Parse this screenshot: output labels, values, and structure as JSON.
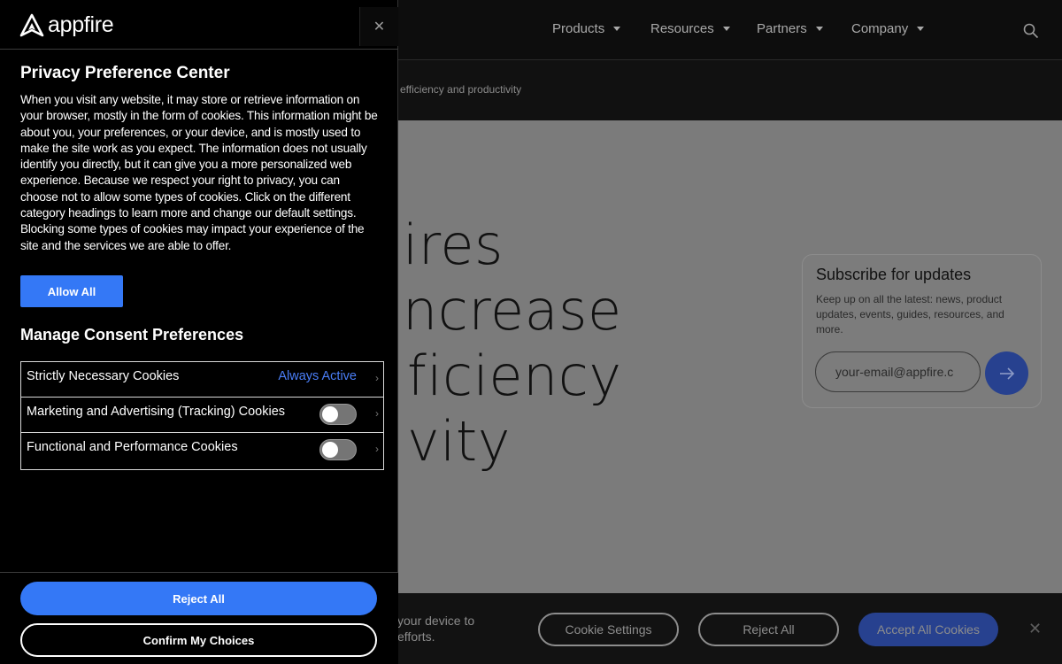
{
  "site": {
    "nav": {
      "items": [
        {
          "label": "Products"
        },
        {
          "label": "Resources"
        },
        {
          "label": "Partners"
        },
        {
          "label": "Company"
        }
      ]
    },
    "subbar_text": "w efficiency and productivity",
    "hero_lines": [
      "ires",
      "ncrease",
      "ficiency",
      "vity"
    ],
    "subscribe": {
      "title": "Subscribe for updates",
      "text": "Keep up on all the latest: news, product updates, events, guides, resources, and more.",
      "email_placeholder": "your-email@appfire.c"
    },
    "cookie_bar": {
      "text": "your device to efforts.",
      "settings_label": "Cookie Settings",
      "reject_label": "Reject All",
      "accept_label": "Accept All Cookies"
    }
  },
  "panel": {
    "logo_text": "appfire",
    "title": "Privacy Preference Center",
    "description": "When you visit any website, it may store or retrieve information on your browser, mostly in the form of cookies. This information might be about you, your preferences, or your device, and is mostly used to make the site work as you expect. The information does not usually identify you directly, but it can give you a more personalized web experience. Because we respect your right to privacy, you can choose not to allow some types of cookies. Click on the different category headings to learn more and change our default settings. Blocking some types of cookies may impact your experience of the site and the services we are able to offer.",
    "allow_all_label": "Allow All",
    "manage_title": "Manage Consent Preferences",
    "categories": [
      {
        "label": "Strictly Necessary Cookies",
        "status": "Always Active"
      },
      {
        "label": "Marketing and Advertising (Tracking) Cookies",
        "enabled": false
      },
      {
        "label": "Functional and Performance Cookies",
        "enabled": false
      }
    ],
    "reject_all_label": "Reject All",
    "confirm_label": "Confirm My Choices"
  },
  "colors": {
    "accent": "#3478f6",
    "status_blue": "#4a7ef7",
    "panel_bg": "#000000"
  }
}
